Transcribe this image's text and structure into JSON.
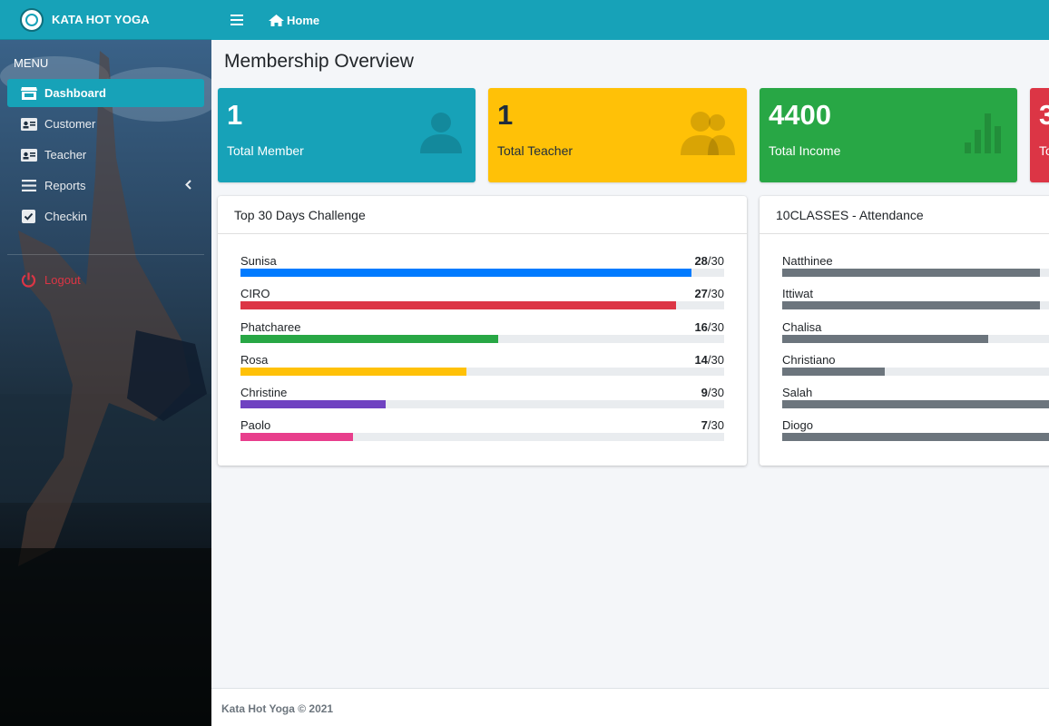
{
  "brand": {
    "name": "KATA HOT YOGA"
  },
  "sidebar": {
    "menu_header": "MENU",
    "items": [
      {
        "label": "Dashboard",
        "icon": "store-icon",
        "active": true
      },
      {
        "label": "Customer",
        "icon": "id-card-icon"
      },
      {
        "label": "Teacher",
        "icon": "id-card-icon"
      },
      {
        "label": "Reports",
        "icon": "list-icon",
        "has_submenu": true
      },
      {
        "label": "Checkin",
        "icon": "check-square-icon"
      }
    ],
    "logout": {
      "label": "Logout",
      "icon": "power-icon"
    }
  },
  "topbar": {
    "home_label": "Home"
  },
  "page": {
    "title": "Membership Overview"
  },
  "stats": [
    {
      "value": "1",
      "label": "Total Member",
      "color": "#17a2b8",
      "icon": "user-icon"
    },
    {
      "value": "1",
      "label": "Total Teacher",
      "color": "#ffc107",
      "icon": "users-icon"
    },
    {
      "value": "4400",
      "label": "Total Income",
      "color": "#28a745",
      "icon": "bar-chart-icon"
    },
    {
      "value": "3",
      "label": "To",
      "color": "#dc3545"
    }
  ],
  "challenge": {
    "title": "Top 30 Days Challenge",
    "rows": [
      {
        "name": "Sunisa",
        "value": 28,
        "max": 30,
        "color": "#007bff"
      },
      {
        "name": "CIRO",
        "value": 27,
        "max": 30,
        "color": "#dc3545"
      },
      {
        "name": "Phatcharee",
        "value": 16,
        "max": 30,
        "color": "#28a745"
      },
      {
        "name": "Rosa",
        "value": 14,
        "max": 30,
        "color": "#ffc107"
      },
      {
        "name": "Christine",
        "value": 9,
        "max": 30,
        "color": "#6f42c1"
      },
      {
        "name": "Paolo",
        "value": 7,
        "max": 30,
        "color": "#e83e8c"
      }
    ]
  },
  "attendance": {
    "title": "10CLASSES - Attendance",
    "bar_color": "#6c757d",
    "rows": [
      {
        "name": "Natthinee",
        "fraction": 0.9
      },
      {
        "name": "Ittiwat",
        "fraction": 0.9
      },
      {
        "name": "Chalisa",
        "fraction": 0.72
      },
      {
        "name": "Christiano",
        "fraction": 0.36
      },
      {
        "name": "Salah",
        "fraction": 1.0
      },
      {
        "name": "Diogo",
        "fraction": 1.0
      }
    ]
  },
  "footer": {
    "text": "Kata Hot Yoga © 2021"
  }
}
